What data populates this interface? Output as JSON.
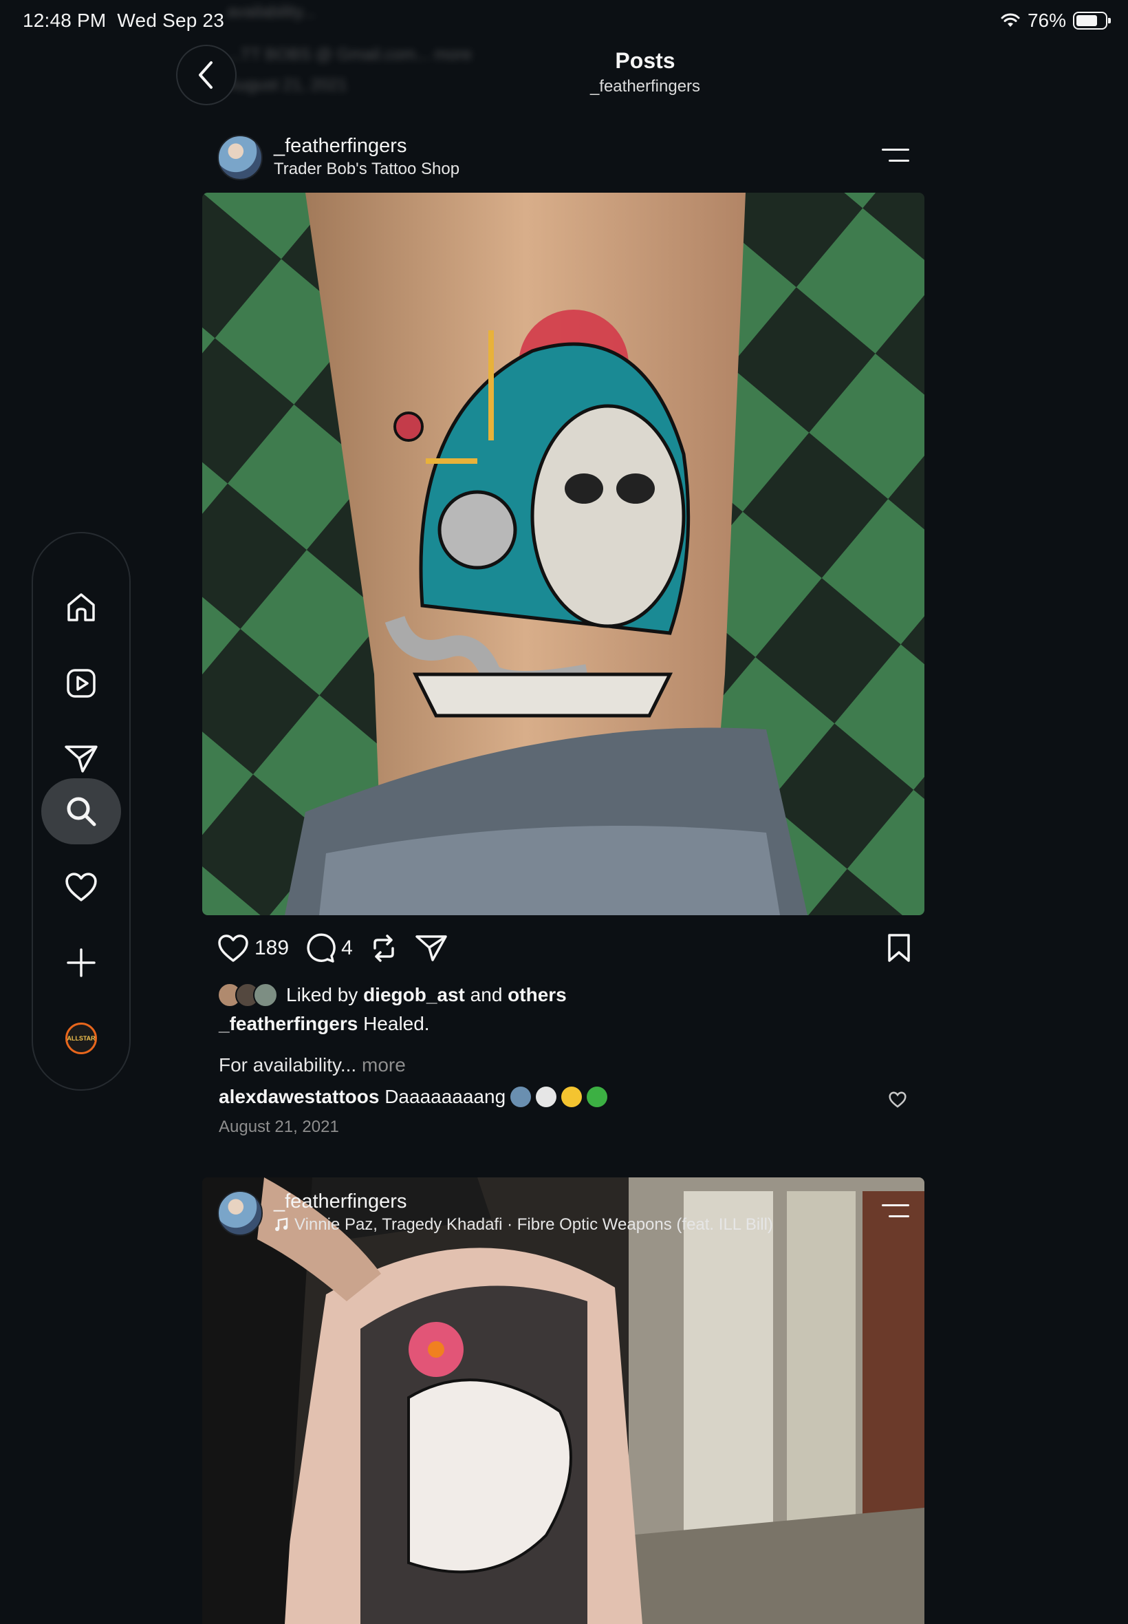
{
  "status_bar": {
    "time": "12:48 PM",
    "date": "Wed Sep 23",
    "battery": "76%",
    "battery_level": 0.76
  },
  "ghost": {
    "line1": "availability...",
    "line2": "...TT BOBS @ Gmail.com... more",
    "line3": "August 21, 2021"
  },
  "header": {
    "title": "Posts",
    "subtitle": "_featherfingers"
  },
  "post1": {
    "username": "_featherfingers",
    "location": "Trader Bob's Tattoo Shop",
    "likes": "189",
    "comments": "4",
    "liked_prefix": "Liked by",
    "liked_user": "diegob_ast",
    "liked_and": "and",
    "liked_others": "others",
    "caption_user": "_featherfingers",
    "caption_text": "Healed.",
    "caption_line2": "For availability...",
    "more_label": "more",
    "comment_user": "alexdawestattoos",
    "comment_text": "Daaaaaaaang",
    "date": "August 21, 2021"
  },
  "post2": {
    "username": "_featherfingers",
    "audio": "Vinnie Paz, Tragedy Khadafi · Fibre Optic Weapons (feat. ILL Bill)"
  },
  "sidebar": {
    "items": [
      "home-icon",
      "reels-icon",
      "direct-icon",
      "search-icon",
      "heart-icon",
      "create-icon",
      "profile-avatar"
    ],
    "active": "search-icon",
    "profile_badge": "ALLSTAR"
  },
  "colors": {
    "background": "#0c1014",
    "text": "#f5f5f5",
    "muted": "#8e8e8e",
    "active_nav": "#3a3e42"
  }
}
